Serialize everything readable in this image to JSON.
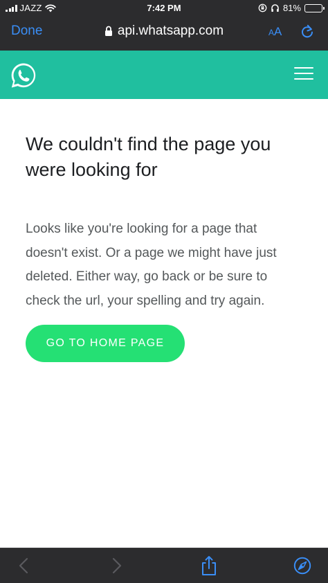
{
  "status_bar": {
    "carrier": "JAZZ",
    "time": "7:42 PM",
    "battery_percent": "81%",
    "battery_level": 0.81,
    "battery_color": "#ffd60a"
  },
  "browser": {
    "done_label": "Done",
    "url": "api.whatsapp.com",
    "text_size_label_small": "A",
    "text_size_label_large": "A",
    "accent_color": "#3a8ef6",
    "icons": [
      "lock-icon",
      "reload-icon",
      "back-icon",
      "forward-icon",
      "share-icon",
      "compass-icon"
    ]
  },
  "site_header": {
    "brand_color": "#20bf9f",
    "icons": [
      "whatsapp-logo-icon",
      "hamburger-menu-icon"
    ]
  },
  "main": {
    "title": "We couldn't find the page you were looking for",
    "description": "Looks like you're looking for a page that doesn't exist. Or a page we might have just deleted. Either way, go back or be sure to check the url, your spelling and try again.",
    "home_button_label": "GO TO HOME PAGE",
    "button_color": "#25e074"
  }
}
